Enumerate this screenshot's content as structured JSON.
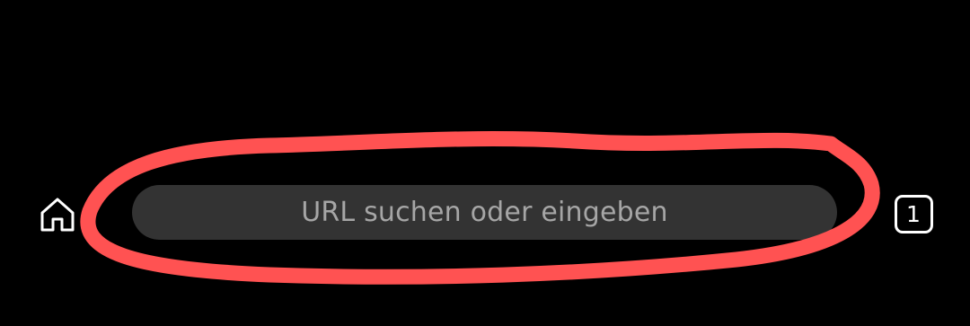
{
  "toolbar": {
    "home_icon": "home-icon",
    "url_placeholder": "URL suchen oder eingeben",
    "tab_count": "1"
  },
  "annotation": {
    "color": "#ff5252"
  },
  "colors": {
    "background": "#000000",
    "url_bar": "#333333",
    "placeholder_text": "#a6a6a6",
    "icon": "#ffffff"
  }
}
